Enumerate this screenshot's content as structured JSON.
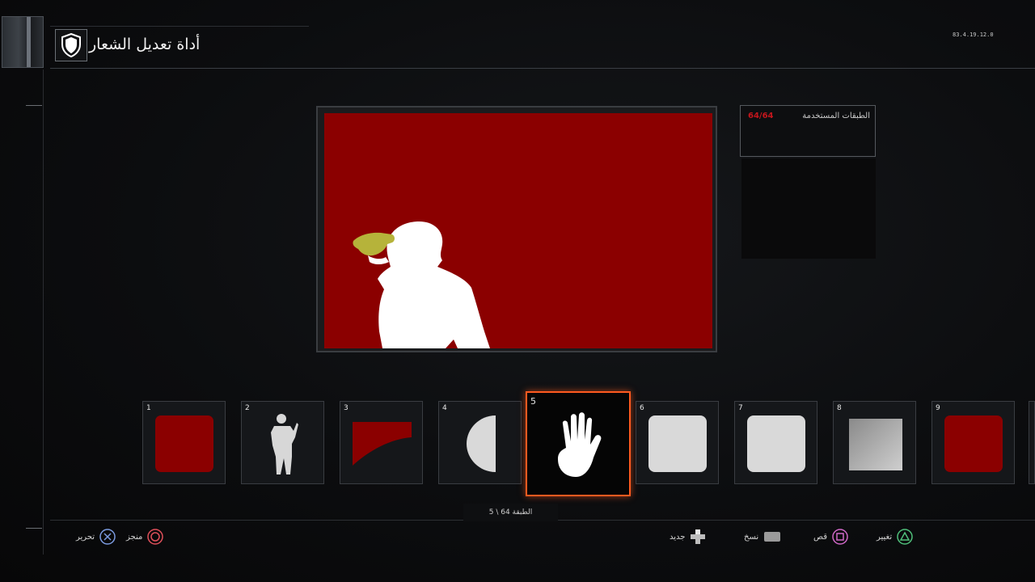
{
  "header": {
    "title": "أداة تعديل الشعار",
    "version": "83.4.19.12.0"
  },
  "layers_panel": {
    "label": "الطبقات المستخدمة",
    "count": "64/64"
  },
  "canvas": {
    "background_color": "#8b0000"
  },
  "layers": [
    {
      "number": "1",
      "icon": "red-square-icon"
    },
    {
      "number": "2",
      "icon": "soldier-silhouette-icon"
    },
    {
      "number": "3",
      "icon": "red-curve-shape-icon"
    },
    {
      "number": "4",
      "icon": "half-circle-icon"
    },
    {
      "number": "5",
      "icon": "hand-icon",
      "selected": true
    },
    {
      "number": "6",
      "icon": "white-square-icon"
    },
    {
      "number": "7",
      "icon": "white-square-icon"
    },
    {
      "number": "8",
      "icon": "gradient-square-icon"
    },
    {
      "number": "9",
      "icon": "red-square-icon"
    }
  ],
  "layer_indicator": "الطبقة 64 \\ 5",
  "controls": {
    "edit": "تحرير",
    "done": "منجز",
    "new": "جديد",
    "copy": "نسخ",
    "cut": "قص",
    "change": "تغيير"
  },
  "colors": {
    "accent": "#ff5a1f",
    "layer_red": "#8b0000",
    "count_red": "#c4161c",
    "yellow_hand": "#b6b33a"
  }
}
